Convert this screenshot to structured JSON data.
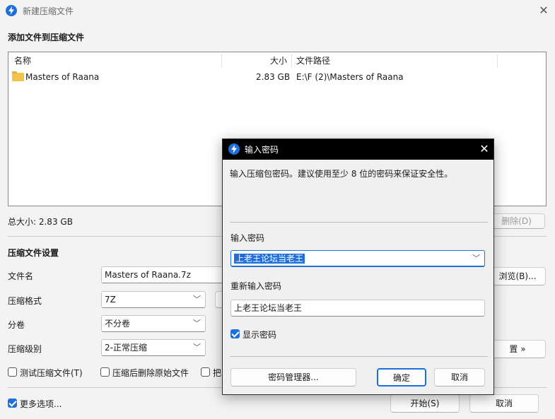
{
  "window": {
    "title": "新建压缩文件",
    "close_glyph": "✕",
    "icon": "lightning-icon"
  },
  "files_section": {
    "title": "添加文件到压缩文件",
    "columns": {
      "name": "名称",
      "size": "大小",
      "path": "文件路径"
    },
    "rows": [
      {
        "name": "Masters of Raana",
        "size": "2.83 GB",
        "path": "E:\\F (2)\\Masters of Raana",
        "icon": "folder-icon"
      }
    ],
    "total_size": "总大小: 2.83 GB",
    "delete_label": "删除(D)"
  },
  "settings": {
    "title": "压缩文件设置",
    "filename_label": "文件名",
    "filename_value": "Masters of Raana.7z",
    "browse_label": "浏览(B)...",
    "format_label": "压缩格式",
    "format_value": "7Z",
    "split_label": "分卷",
    "split_value": "不分卷",
    "level_label": "压缩级别",
    "level_value": "2-正常压缩",
    "advanced_label": "置 »",
    "test_label": "测试压缩文件(T)",
    "delete_after_label": "压缩后删除原始文件",
    "partial_label": "把",
    "more_options_label": "更多选项...",
    "start_label": "开始(S)",
    "cancel_label": "取消"
  },
  "password_dialog": {
    "title": "输入密码",
    "close_glyph": "✕",
    "hint": "输入压缩包密码。建议使用至少 8 位的密码来保证安全性。",
    "password_label": "输入密码",
    "password_value": "上老王论坛当老王",
    "reenter_label": "重新输入密码",
    "reenter_value": "上老王论坛当老王",
    "show_password_label": "显示密码",
    "manager_label": "密码管理器...",
    "ok_label": "确定",
    "cancel_label": "取消"
  },
  "colors": {
    "accent": "#1e6fd9",
    "folder": "#f3c24c",
    "dialog_titlebar": "#000000"
  }
}
